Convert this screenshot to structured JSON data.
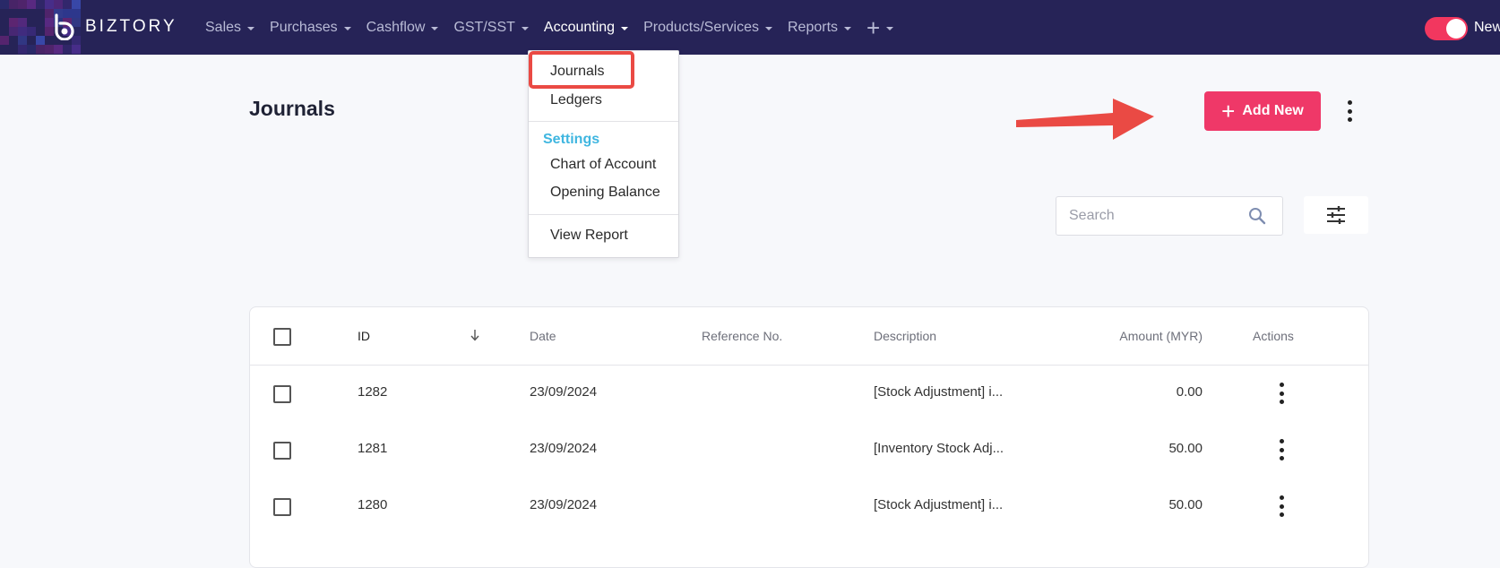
{
  "brand": {
    "name": "BIZTORY"
  },
  "nav": {
    "items": [
      {
        "label": "Sales",
        "active": false
      },
      {
        "label": "Purchases",
        "active": false
      },
      {
        "label": "Cashflow",
        "active": false
      },
      {
        "label": "GST/SST",
        "active": false
      },
      {
        "label": "Accounting",
        "active": true
      },
      {
        "label": "Products/Services",
        "active": false
      },
      {
        "label": "Reports",
        "active": false
      }
    ],
    "add_icon": "plus-icon",
    "toggle_label": "New",
    "toggle_on": true
  },
  "dropdown": {
    "items_top": [
      "Journals",
      "Ledgers"
    ],
    "section_label": "Settings",
    "items_settings": [
      "Chart of Account",
      "Opening Balance"
    ],
    "items_bottom": [
      "View Report"
    ],
    "highlighted": "Journals"
  },
  "page": {
    "title": "Journals",
    "add_button_label": "Add New"
  },
  "search": {
    "placeholder": "Search",
    "value": ""
  },
  "table": {
    "columns": {
      "id": "ID",
      "date": "Date",
      "reference": "Reference No.",
      "description": "Description",
      "amount": "Amount (MYR)",
      "actions": "Actions"
    },
    "sort": {
      "column": "ID",
      "direction": "descending"
    },
    "rows": [
      {
        "id": "1282",
        "date": "23/09/2024",
        "reference": "",
        "description": "[Stock Adjustment] i...",
        "amount": "0.00"
      },
      {
        "id": "1281",
        "date": "23/09/2024",
        "reference": "",
        "description": "[Inventory Stock Adj...",
        "amount": "50.00"
      },
      {
        "id": "1280",
        "date": "23/09/2024",
        "reference": "",
        "description": "[Stock Adjustment] i...",
        "amount": "50.00"
      }
    ]
  },
  "colors": {
    "topbar": "#262357",
    "accent": "#ef3868",
    "settings_label": "#3fb6e0",
    "annotation": "#ea4a44"
  }
}
